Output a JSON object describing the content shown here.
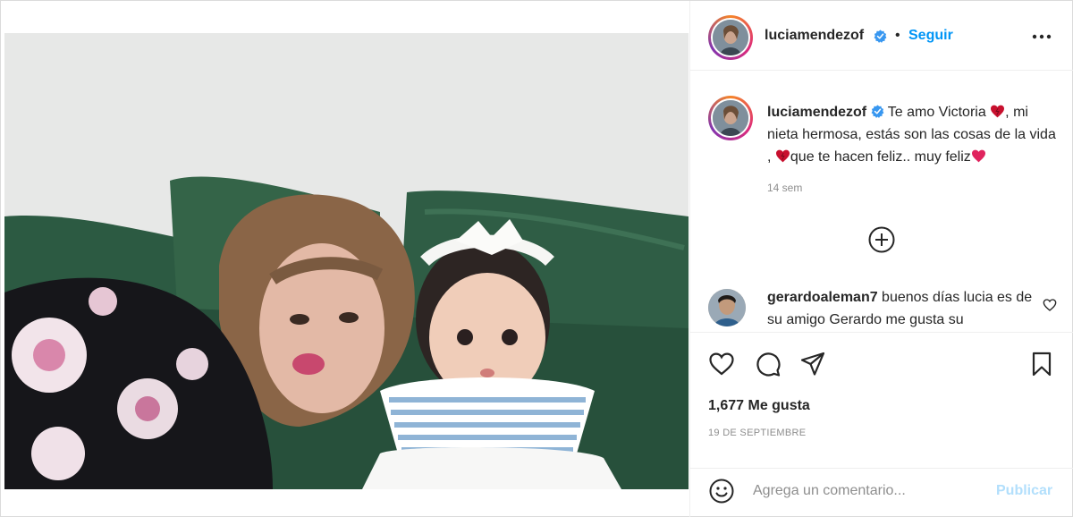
{
  "header": {
    "username": "luciamendezof",
    "verified_icon": "verified-badge-icon",
    "follow_label": "Seguir",
    "separator": "•",
    "more_icon": "more-options-icon"
  },
  "caption": {
    "username": "luciamendezof",
    "segment_1": " Te amo Victoria ",
    "segment_2": ", mi nieta hermosa, estás son las cosas de la vida , ",
    "segment_3": "que te hacen feliz.. muy feliz",
    "time": "14 sem"
  },
  "load_more_icon": "plus-circle-icon",
  "comment": {
    "username": "gerardoaleman7",
    "text": " buenos días lucia es de su amigo Gerardo me gusta su"
  },
  "actions": {
    "likes": "1,677 Me gusta",
    "date": "19 DE SEPTIEMBRE"
  },
  "add_comment": {
    "placeholder": "Agrega un comentario...",
    "publish_label": "Publicar"
  },
  "colors": {
    "accent": "#0095f6",
    "publish_disabled": "#b2dffc",
    "heart_red": "#e0245e",
    "sofa_green": "#2f5a43"
  }
}
